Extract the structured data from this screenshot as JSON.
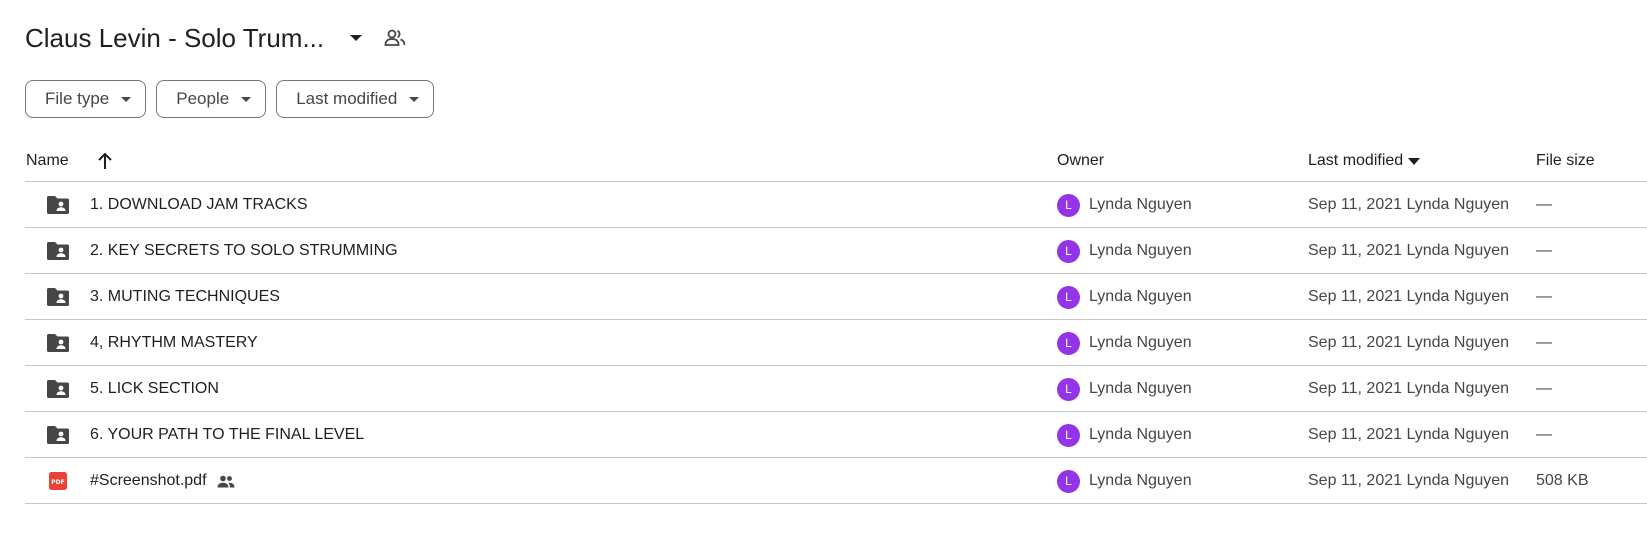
{
  "header": {
    "title": "Claus Levin - Solo Trum...",
    "icons": {
      "caret": "caret-down-icon",
      "shared": "shared-people-icon"
    }
  },
  "filters": [
    {
      "label": "File type"
    },
    {
      "label": "People"
    },
    {
      "label": "Last modified"
    }
  ],
  "columns": {
    "name": "Name",
    "owner": "Owner",
    "last_modified": "Last modified",
    "file_size": "File size"
  },
  "colors": {
    "avatar": "#9334e6",
    "folder_icon": "#444746",
    "pdf_icon": "#ea4335"
  },
  "rows": [
    {
      "type": "shared-folder",
      "name": "1. DOWNLOAD JAM TRACKS",
      "owner_initial": "L",
      "owner": "Lynda Nguyen",
      "modified": "Sep 11, 2021 Lynda Nguyen",
      "size": "—"
    },
    {
      "type": "shared-folder",
      "name": "2. KEY SECRETS TO SOLO STRUMMING",
      "owner_initial": "L",
      "owner": "Lynda Nguyen",
      "modified": "Sep 11, 2021 Lynda Nguyen",
      "size": "—"
    },
    {
      "type": "shared-folder",
      "name": "3. MUTING TECHNIQUES",
      "owner_initial": "L",
      "owner": "Lynda Nguyen",
      "modified": "Sep 11, 2021 Lynda Nguyen",
      "size": "—"
    },
    {
      "type": "shared-folder",
      "name": "4, RHYTHM MASTERY",
      "owner_initial": "L",
      "owner": "Lynda Nguyen",
      "modified": "Sep 11, 2021 Lynda Nguyen",
      "size": "—"
    },
    {
      "type": "shared-folder",
      "name": "5. LICK SECTION",
      "owner_initial": "L",
      "owner": "Lynda Nguyen",
      "modified": "Sep 11, 2021 Lynda Nguyen",
      "size": "—"
    },
    {
      "type": "shared-folder",
      "name": "6. YOUR PATH TO THE FINAL LEVEL",
      "owner_initial": "L",
      "owner": "Lynda Nguyen",
      "modified": "Sep 11, 2021 Lynda Nguyen",
      "size": "—"
    },
    {
      "type": "pdf",
      "name": "#Screenshot.pdf",
      "shared": true,
      "owner_initial": "L",
      "owner": "Lynda Nguyen",
      "modified": "Sep 11, 2021 Lynda Nguyen",
      "size": "508 KB"
    }
  ]
}
